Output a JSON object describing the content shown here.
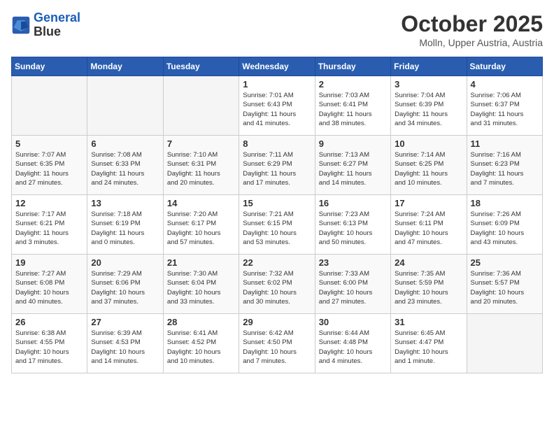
{
  "header": {
    "logo_line1": "General",
    "logo_line2": "Blue",
    "month": "October 2025",
    "location": "Molln, Upper Austria, Austria"
  },
  "weekdays": [
    "Sunday",
    "Monday",
    "Tuesday",
    "Wednesday",
    "Thursday",
    "Friday",
    "Saturday"
  ],
  "weeks": [
    [
      {
        "day": "",
        "info": ""
      },
      {
        "day": "",
        "info": ""
      },
      {
        "day": "",
        "info": ""
      },
      {
        "day": "1",
        "info": "Sunrise: 7:01 AM\nSunset: 6:43 PM\nDaylight: 11 hours\nand 41 minutes."
      },
      {
        "day": "2",
        "info": "Sunrise: 7:03 AM\nSunset: 6:41 PM\nDaylight: 11 hours\nand 38 minutes."
      },
      {
        "day": "3",
        "info": "Sunrise: 7:04 AM\nSunset: 6:39 PM\nDaylight: 11 hours\nand 34 minutes."
      },
      {
        "day": "4",
        "info": "Sunrise: 7:06 AM\nSunset: 6:37 PM\nDaylight: 11 hours\nand 31 minutes."
      }
    ],
    [
      {
        "day": "5",
        "info": "Sunrise: 7:07 AM\nSunset: 6:35 PM\nDaylight: 11 hours\nand 27 minutes."
      },
      {
        "day": "6",
        "info": "Sunrise: 7:08 AM\nSunset: 6:33 PM\nDaylight: 11 hours\nand 24 minutes."
      },
      {
        "day": "7",
        "info": "Sunrise: 7:10 AM\nSunset: 6:31 PM\nDaylight: 11 hours\nand 20 minutes."
      },
      {
        "day": "8",
        "info": "Sunrise: 7:11 AM\nSunset: 6:29 PM\nDaylight: 11 hours\nand 17 minutes."
      },
      {
        "day": "9",
        "info": "Sunrise: 7:13 AM\nSunset: 6:27 PM\nDaylight: 11 hours\nand 14 minutes."
      },
      {
        "day": "10",
        "info": "Sunrise: 7:14 AM\nSunset: 6:25 PM\nDaylight: 11 hours\nand 10 minutes."
      },
      {
        "day": "11",
        "info": "Sunrise: 7:16 AM\nSunset: 6:23 PM\nDaylight: 11 hours\nand 7 minutes."
      }
    ],
    [
      {
        "day": "12",
        "info": "Sunrise: 7:17 AM\nSunset: 6:21 PM\nDaylight: 11 hours\nand 3 minutes."
      },
      {
        "day": "13",
        "info": "Sunrise: 7:18 AM\nSunset: 6:19 PM\nDaylight: 11 hours\nand 0 minutes."
      },
      {
        "day": "14",
        "info": "Sunrise: 7:20 AM\nSunset: 6:17 PM\nDaylight: 10 hours\nand 57 minutes."
      },
      {
        "day": "15",
        "info": "Sunrise: 7:21 AM\nSunset: 6:15 PM\nDaylight: 10 hours\nand 53 minutes."
      },
      {
        "day": "16",
        "info": "Sunrise: 7:23 AM\nSunset: 6:13 PM\nDaylight: 10 hours\nand 50 minutes."
      },
      {
        "day": "17",
        "info": "Sunrise: 7:24 AM\nSunset: 6:11 PM\nDaylight: 10 hours\nand 47 minutes."
      },
      {
        "day": "18",
        "info": "Sunrise: 7:26 AM\nSunset: 6:09 PM\nDaylight: 10 hours\nand 43 minutes."
      }
    ],
    [
      {
        "day": "19",
        "info": "Sunrise: 7:27 AM\nSunset: 6:08 PM\nDaylight: 10 hours\nand 40 minutes."
      },
      {
        "day": "20",
        "info": "Sunrise: 7:29 AM\nSunset: 6:06 PM\nDaylight: 10 hours\nand 37 minutes."
      },
      {
        "day": "21",
        "info": "Sunrise: 7:30 AM\nSunset: 6:04 PM\nDaylight: 10 hours\nand 33 minutes."
      },
      {
        "day": "22",
        "info": "Sunrise: 7:32 AM\nSunset: 6:02 PM\nDaylight: 10 hours\nand 30 minutes."
      },
      {
        "day": "23",
        "info": "Sunrise: 7:33 AM\nSunset: 6:00 PM\nDaylight: 10 hours\nand 27 minutes."
      },
      {
        "day": "24",
        "info": "Sunrise: 7:35 AM\nSunset: 5:59 PM\nDaylight: 10 hours\nand 23 minutes."
      },
      {
        "day": "25",
        "info": "Sunrise: 7:36 AM\nSunset: 5:57 PM\nDaylight: 10 hours\nand 20 minutes."
      }
    ],
    [
      {
        "day": "26",
        "info": "Sunrise: 6:38 AM\nSunset: 4:55 PM\nDaylight: 10 hours\nand 17 minutes."
      },
      {
        "day": "27",
        "info": "Sunrise: 6:39 AM\nSunset: 4:53 PM\nDaylight: 10 hours\nand 14 minutes."
      },
      {
        "day": "28",
        "info": "Sunrise: 6:41 AM\nSunset: 4:52 PM\nDaylight: 10 hours\nand 10 minutes."
      },
      {
        "day": "29",
        "info": "Sunrise: 6:42 AM\nSunset: 4:50 PM\nDaylight: 10 hours\nand 7 minutes."
      },
      {
        "day": "30",
        "info": "Sunrise: 6:44 AM\nSunset: 4:48 PM\nDaylight: 10 hours\nand 4 minutes."
      },
      {
        "day": "31",
        "info": "Sunrise: 6:45 AM\nSunset: 4:47 PM\nDaylight: 10 hours\nand 1 minute."
      },
      {
        "day": "",
        "info": ""
      }
    ]
  ]
}
